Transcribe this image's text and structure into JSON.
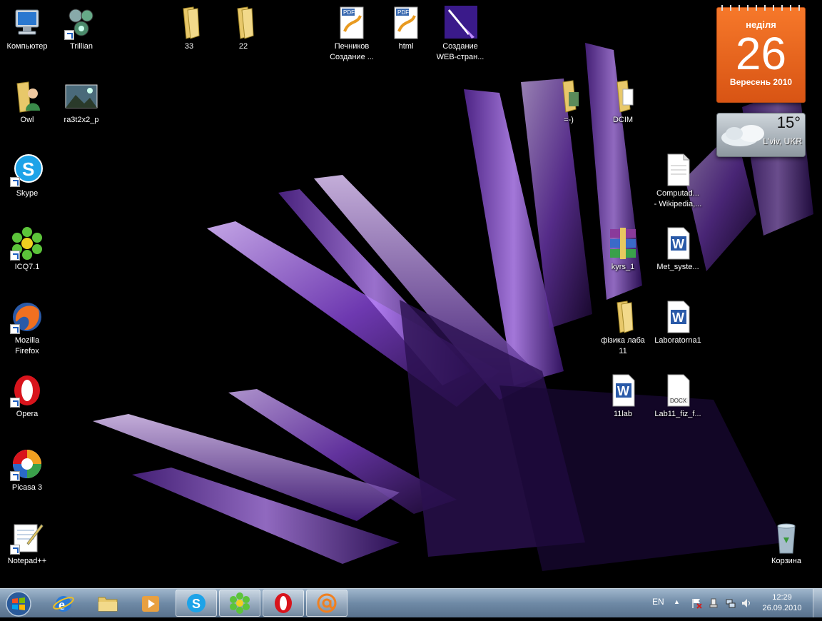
{
  "desktop_icons": [
    {
      "name": "Компьютер",
      "kind": "computer-icon"
    },
    {
      "name": "Trillian",
      "kind": "trillian-icon"
    },
    {
      "name": "33",
      "kind": "folder-icon"
    },
    {
      "name": "22",
      "kind": "folder-icon"
    },
    {
      "name": "Печников\nСоздание ...",
      "kind": "pdf-icon"
    },
    {
      "name": "html",
      "kind": "pdf-icon"
    },
    {
      "name": "Создание\nWEB-стран...",
      "kind": "app-icon"
    },
    {
      "name": "Owl",
      "kind": "folder-user-icon"
    },
    {
      "name": "ra3t2x2_p",
      "kind": "image-icon"
    },
    {
      "name": "=-)",
      "kind": "folder-icon"
    },
    {
      "name": "DCIM",
      "kind": "folder-icon"
    },
    {
      "name": "Skype",
      "kind": "skype-icon"
    },
    {
      "name": "Computad...\n- Wikipedia,...",
      "kind": "document-icon"
    },
    {
      "name": "ICQ7.1",
      "kind": "icq-icon"
    },
    {
      "name": "kyrs_1",
      "kind": "winrar-icon"
    },
    {
      "name": "Met_syste...",
      "kind": "word-icon"
    },
    {
      "name": "Mozilla\nFirefox",
      "kind": "firefox-icon"
    },
    {
      "name": "фізика лаба\n11",
      "kind": "folder-icon"
    },
    {
      "name": "Laboratorna1",
      "kind": "word-icon"
    },
    {
      "name": "Opera",
      "kind": "opera-icon"
    },
    {
      "name": "11lab",
      "kind": "word-icon"
    },
    {
      "name": "Lab11_fiz_f...",
      "kind": "docx-icon"
    },
    {
      "name": "Picasa 3",
      "kind": "picasa-icon"
    },
    {
      "name": "Notepad++",
      "kind": "notepad-icon"
    },
    {
      "name": "Корзина",
      "kind": "recycle-bin-icon"
    }
  ],
  "calendar": {
    "day_name": "неділя",
    "day_number": "26",
    "month_year": "Вересень 2010"
  },
  "weather": {
    "temperature": "15°",
    "city": "L'viv, UKR"
  },
  "taskbar": {
    "buttons": [
      "ie-icon",
      "explorer-icon",
      "media-player-icon",
      "skype-icon",
      "icq-icon",
      "opera-icon",
      "mail-agent-icon"
    ],
    "language": "EN",
    "time": "12:29",
    "date": "26.09.2010"
  },
  "colors": {
    "accent": "#f06a1f",
    "taskbar": "#6f8aa6",
    "wallpaper_crystal": "#7a4ab8"
  }
}
